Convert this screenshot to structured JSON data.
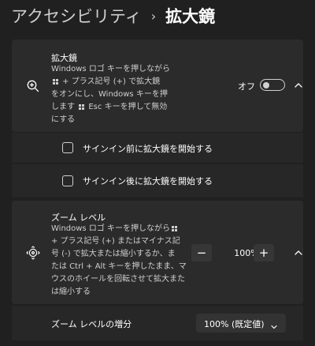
{
  "breadcrumb": {
    "parent": "アクセシビリティ",
    "separator": "›",
    "current": "拡大鏡"
  },
  "magnifier": {
    "icon": "magnifier-zoom-in-icon",
    "title": "拡大鏡",
    "description": {
      "line1": "Windows ロゴ キーを押しながら",
      "line2_after_glyph": " + プラス記号 (+) で拡大鏡",
      "line3": "をオンにし、Windows キーを押",
      "line4_before_glyph": "します ",
      "line4_after_glyph": " Esc キーを押して無効",
      "line5": "にする"
    },
    "toggle_state_label": "オフ",
    "toggle_on": false
  },
  "signin_options": {
    "before_signin": {
      "label": "サインイン前に拡大鏡を開始する",
      "checked": false
    },
    "after_signin": {
      "label": "サインイン後に拡大鏡を開始する",
      "checked": false
    }
  },
  "zoom_level": {
    "icon": "zoom-move-icon",
    "title": "ズーム レベル",
    "description": {
      "line1_before_glyph": "Windows ロゴ キーを押しながら",
      "line2": "+ プラス記号 (+) またはマイナス記",
      "line3": "号 (-) で拡大または縮小するか、ま",
      "line4": "たは Ctrl + Alt キーを押したまま、マ",
      "line5": "ウスのホイールを回転させて拡大また",
      "line6": "は縮小する"
    },
    "decrease_label": "−",
    "value": "100%",
    "increase_label": "+"
  },
  "zoom_increment": {
    "label": "ズーム レベルの増分",
    "selected": "100% (既定値)"
  },
  "colors": {
    "background": "#202020",
    "card": "#2b2b2b",
    "subcard": "#272727"
  }
}
